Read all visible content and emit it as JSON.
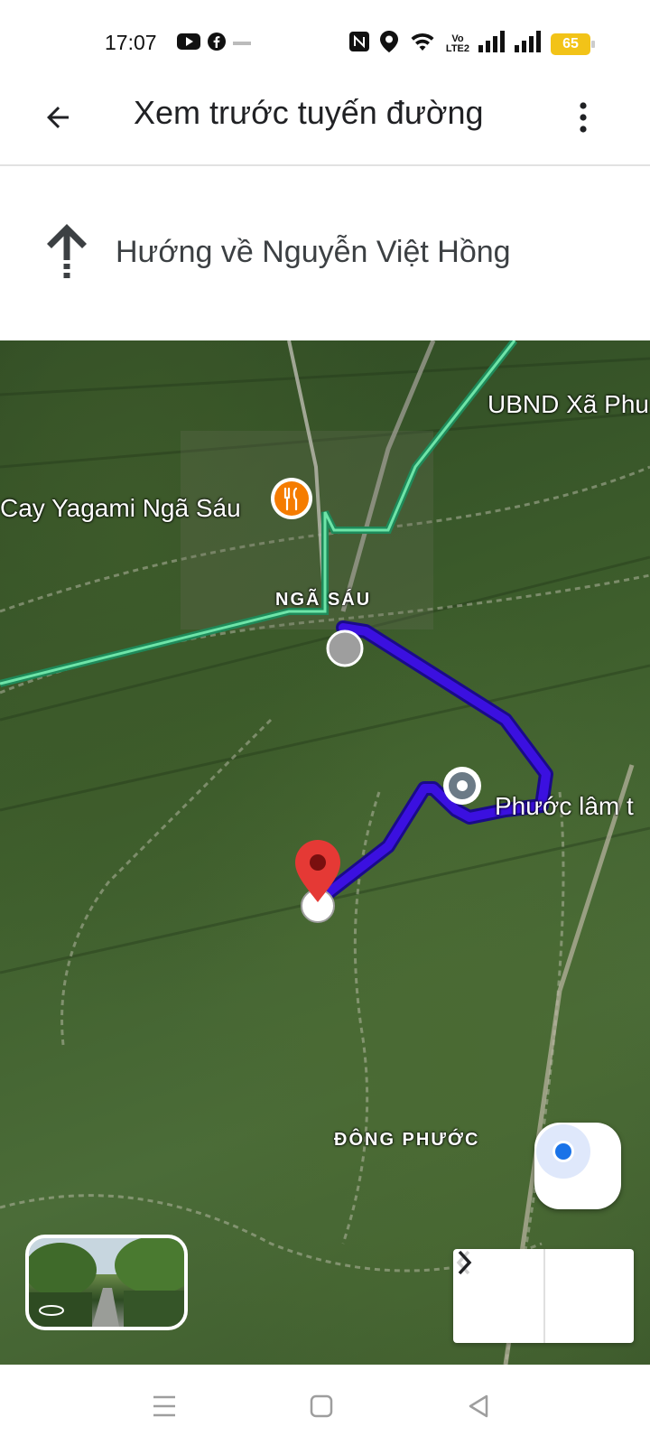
{
  "status_bar": {
    "time": "17:07",
    "battery": "65",
    "network_label_top": "Vo",
    "network_label_bottom": "LTE2",
    "icons": [
      "youtube-icon",
      "facebook-icon",
      "nfc-icon",
      "location-icon",
      "wifi-icon",
      "signal-icon",
      "signal-icon",
      "battery-icon"
    ]
  },
  "app_bar": {
    "title": "Xem trước tuyến đường",
    "back_icon": "arrow-left-icon",
    "more_icon": "more-vert-icon"
  },
  "instruction": {
    "icon": "arrow-up-icon",
    "text": "Hướng về Nguyễn Việt Hồng"
  },
  "map": {
    "labels": {
      "ubnd": "UBND Xã Phu",
      "cay": "Cay Yagami Ngã Sáu",
      "ngasau": "NGÃ SÁU",
      "phuoclam": "Phước lâm t",
      "dongphuoc": "ĐÔNG PHƯỚC"
    },
    "route_color": "#3b10e0",
    "road_color": "#3ec486",
    "pin_color": "#e53935",
    "restaurant_color": "#f57c00"
  },
  "controls": {
    "prev_icon": "chevron-left-icon",
    "next_icon": "chevron-right-icon",
    "locate_icon": "my-location-icon"
  },
  "system_nav": {
    "icons": [
      "menu-icon",
      "home-icon",
      "back-icon"
    ]
  }
}
